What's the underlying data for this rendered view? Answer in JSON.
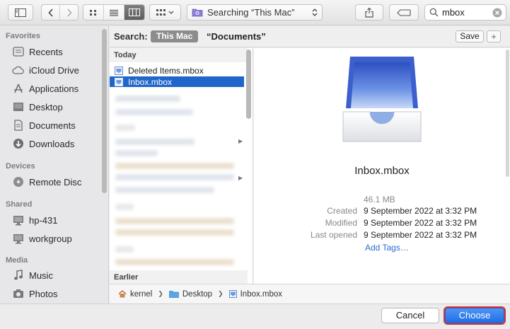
{
  "toolbar": {
    "location_label": "Searching “This Mac”",
    "search_value": "mbox"
  },
  "sidebar": {
    "sections": [
      {
        "title": "Favorites",
        "items": [
          "Recents",
          "iCloud Drive",
          "Applications",
          "Desktop",
          "Documents",
          "Downloads"
        ]
      },
      {
        "title": "Devices",
        "items": [
          "Remote Disc"
        ]
      },
      {
        "title": "Shared",
        "items": [
          "hp-431",
          "workgroup"
        ]
      },
      {
        "title": "Media",
        "items": [
          "Music",
          "Photos"
        ]
      }
    ]
  },
  "scope": {
    "label": "Search:",
    "this_mac": "This Mac",
    "documents": "“Documents”",
    "save_label": "Save",
    "plus_label": "+"
  },
  "filelist": {
    "group_today": "Today",
    "group_earlier": "Earlier",
    "files": [
      "Deleted Items.mbox",
      "Inbox.mbox"
    ]
  },
  "preview": {
    "name": "Inbox.mbox",
    "size": "46.1 MB",
    "created_label": "Created",
    "created_value": "9 September 2022 at 3:32 PM",
    "modified_label": "Modified",
    "modified_value": "9 September 2022 at 3:32 PM",
    "opened_label": "Last opened",
    "opened_value": "9 September 2022 at 3:32 PM",
    "add_tags": "Add Tags…"
  },
  "pathbar": [
    "kernel",
    "Desktop",
    "Inbox.mbox"
  ],
  "buttons": {
    "cancel": "Cancel",
    "choose": "Choose"
  },
  "colors": {
    "selection": "#1e66c9",
    "accent": "#2c6cd0",
    "choose_outline": "#d6313a"
  }
}
